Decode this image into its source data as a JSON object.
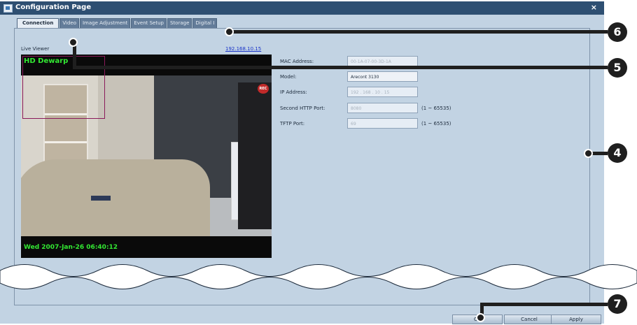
{
  "window": {
    "title": "Configuration Page",
    "close_glyph": "×"
  },
  "tabs": [
    {
      "label": "Connection",
      "active": true
    },
    {
      "label": "Video"
    },
    {
      "label": "Image Adjustment"
    },
    {
      "label": "Event Setup"
    },
    {
      "label": "Storage"
    },
    {
      "label": "Digital I"
    }
  ],
  "viewer": {
    "label": "Live Viewer",
    "ip_link": "192.168.10.15",
    "osd_top": "HD Dewarp",
    "osd_bottom": "Wed 2007-Jan-26 06:40:12",
    "rec_badge": "REC"
  },
  "form": {
    "mac_label": "MAC Address:",
    "mac_value": "00-1A-07-00-3D-1A",
    "model_label": "Model:",
    "model_value": "Arecont 3130",
    "ip_label": "IP Address:",
    "ip_value": "192 . 168 . 10 . 15",
    "http_label": "Second HTTP Port:",
    "http_value": "8080",
    "http_range": "(1 ~ 65535)",
    "tftp_label": "TFTP Port:",
    "tftp_value": "69",
    "tftp_range": "(1 ~ 65535)"
  },
  "buttons": {
    "ok": "OK",
    "cancel": "Cancel",
    "apply": "Apply"
  },
  "callouts": {
    "c4": "4",
    "c5": "5",
    "c6": "6",
    "c7": "7"
  },
  "colors": {
    "titlebar": "#2e4f72",
    "panel": "#c2d3e3",
    "link": "#1a34c9",
    "osd": "#33e833"
  }
}
